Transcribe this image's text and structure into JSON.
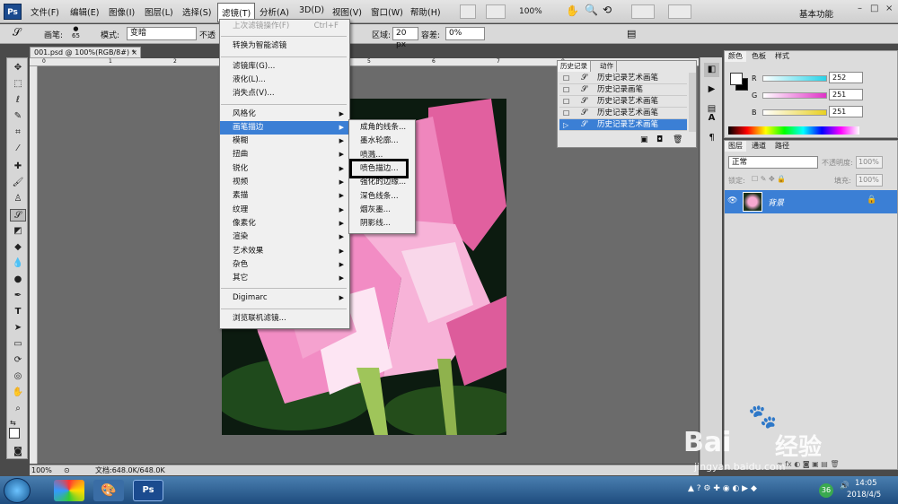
{
  "menubar": {
    "logo": "Ps",
    "items": [
      "文件(F)",
      "编辑(E)",
      "图像(I)",
      "图层(L)",
      "选择(S)",
      "滤镜(T)",
      "分析(A)",
      "3D(D)",
      "视图(V)",
      "窗口(W)",
      "帮助(H)"
    ],
    "active_index": 5,
    "zoom": "100%",
    "workspace": "基本功能",
    "win_controls": [
      "–",
      "□",
      "×"
    ]
  },
  "options": {
    "brush_label": "画笔:",
    "brush_size": "65",
    "mode_label": "模式:",
    "mode_value": "变暗",
    "opacity_label": "不透",
    "area_label": "区域:",
    "area_value": "20 px",
    "tolerance_label": "容差:",
    "tolerance_value": "0%"
  },
  "document": {
    "tab": "001.psd @ 100%(RGB/8#) *",
    "ruler_marks": [
      "0",
      "1",
      "2",
      "3",
      "4",
      "5",
      "6",
      "7",
      "8"
    ],
    "zoom": "100%",
    "docinfo": "文档:648.0K/648.0K"
  },
  "filter_menu": {
    "items": [
      {
        "label": "上次滤镜操作(F)",
        "shortcut": "Ctrl+F",
        "disabled": true
      },
      {
        "sep": true
      },
      {
        "label": "转换为智能滤镜"
      },
      {
        "sep": true
      },
      {
        "label": "滤镜库(G)..."
      },
      {
        "label": "液化(L)..."
      },
      {
        "label": "消失点(V)..."
      },
      {
        "sep": true
      },
      {
        "label": "风格化",
        "sub": true
      },
      {
        "label": "画笔描边",
        "sub": true,
        "highlight": true
      },
      {
        "label": "模糊",
        "sub": true
      },
      {
        "label": "扭曲",
        "sub": true
      },
      {
        "label": "锐化",
        "sub": true
      },
      {
        "label": "视频",
        "sub": true
      },
      {
        "label": "素描",
        "sub": true
      },
      {
        "label": "纹理",
        "sub": true
      },
      {
        "label": "像素化",
        "sub": true
      },
      {
        "label": "渲染",
        "sub": true
      },
      {
        "label": "艺术效果",
        "sub": true
      },
      {
        "label": "杂色",
        "sub": true
      },
      {
        "label": "其它",
        "sub": true
      },
      {
        "sep": true
      },
      {
        "label": "Digimarc",
        "sub": true
      },
      {
        "sep": true
      },
      {
        "label": "浏览联机滤镜..."
      }
    ],
    "submenu": [
      "成角的线条...",
      "墨水轮廓...",
      "喷溅...",
      "喷色描边...",
      "强化的边缘...",
      "深色线条...",
      "烟灰墨...",
      "阴影线..."
    ],
    "submenu_boxed_index": 3
  },
  "history": {
    "tabs": [
      "历史记录",
      "动作"
    ],
    "rows": [
      "历史记录艺术画笔",
      "历史记录画笔",
      "历史记录艺术画笔",
      "历史记录艺术画笔",
      "历史记录艺术画笔"
    ],
    "selected_index": 4
  },
  "color_panel": {
    "tabs": [
      "颜色",
      "色板",
      "样式"
    ],
    "channels": [
      {
        "label": "R",
        "value": "252",
        "color": "#27d3e8"
      },
      {
        "label": "G",
        "value": "251",
        "color": "#e033c8"
      },
      {
        "label": "B",
        "value": "251",
        "color": "#e8d021"
      }
    ]
  },
  "layers_panel": {
    "tabs": [
      "图层",
      "通道",
      "路径"
    ],
    "blend_mode": "正常",
    "opacity_label": "不透明度:",
    "opacity_value": "100%",
    "lock_label": "锁定:",
    "fill_label": "填充:",
    "fill_value": "100%",
    "layer_name": "背景"
  },
  "taskbar": {
    "time": "14:05",
    "date": "2018/4/5",
    "badge": "36",
    "ps_label": "Ps"
  },
  "watermark": {
    "brand": "Bai",
    "brand2": "经验",
    "url": "jingyan.baidu.com"
  }
}
